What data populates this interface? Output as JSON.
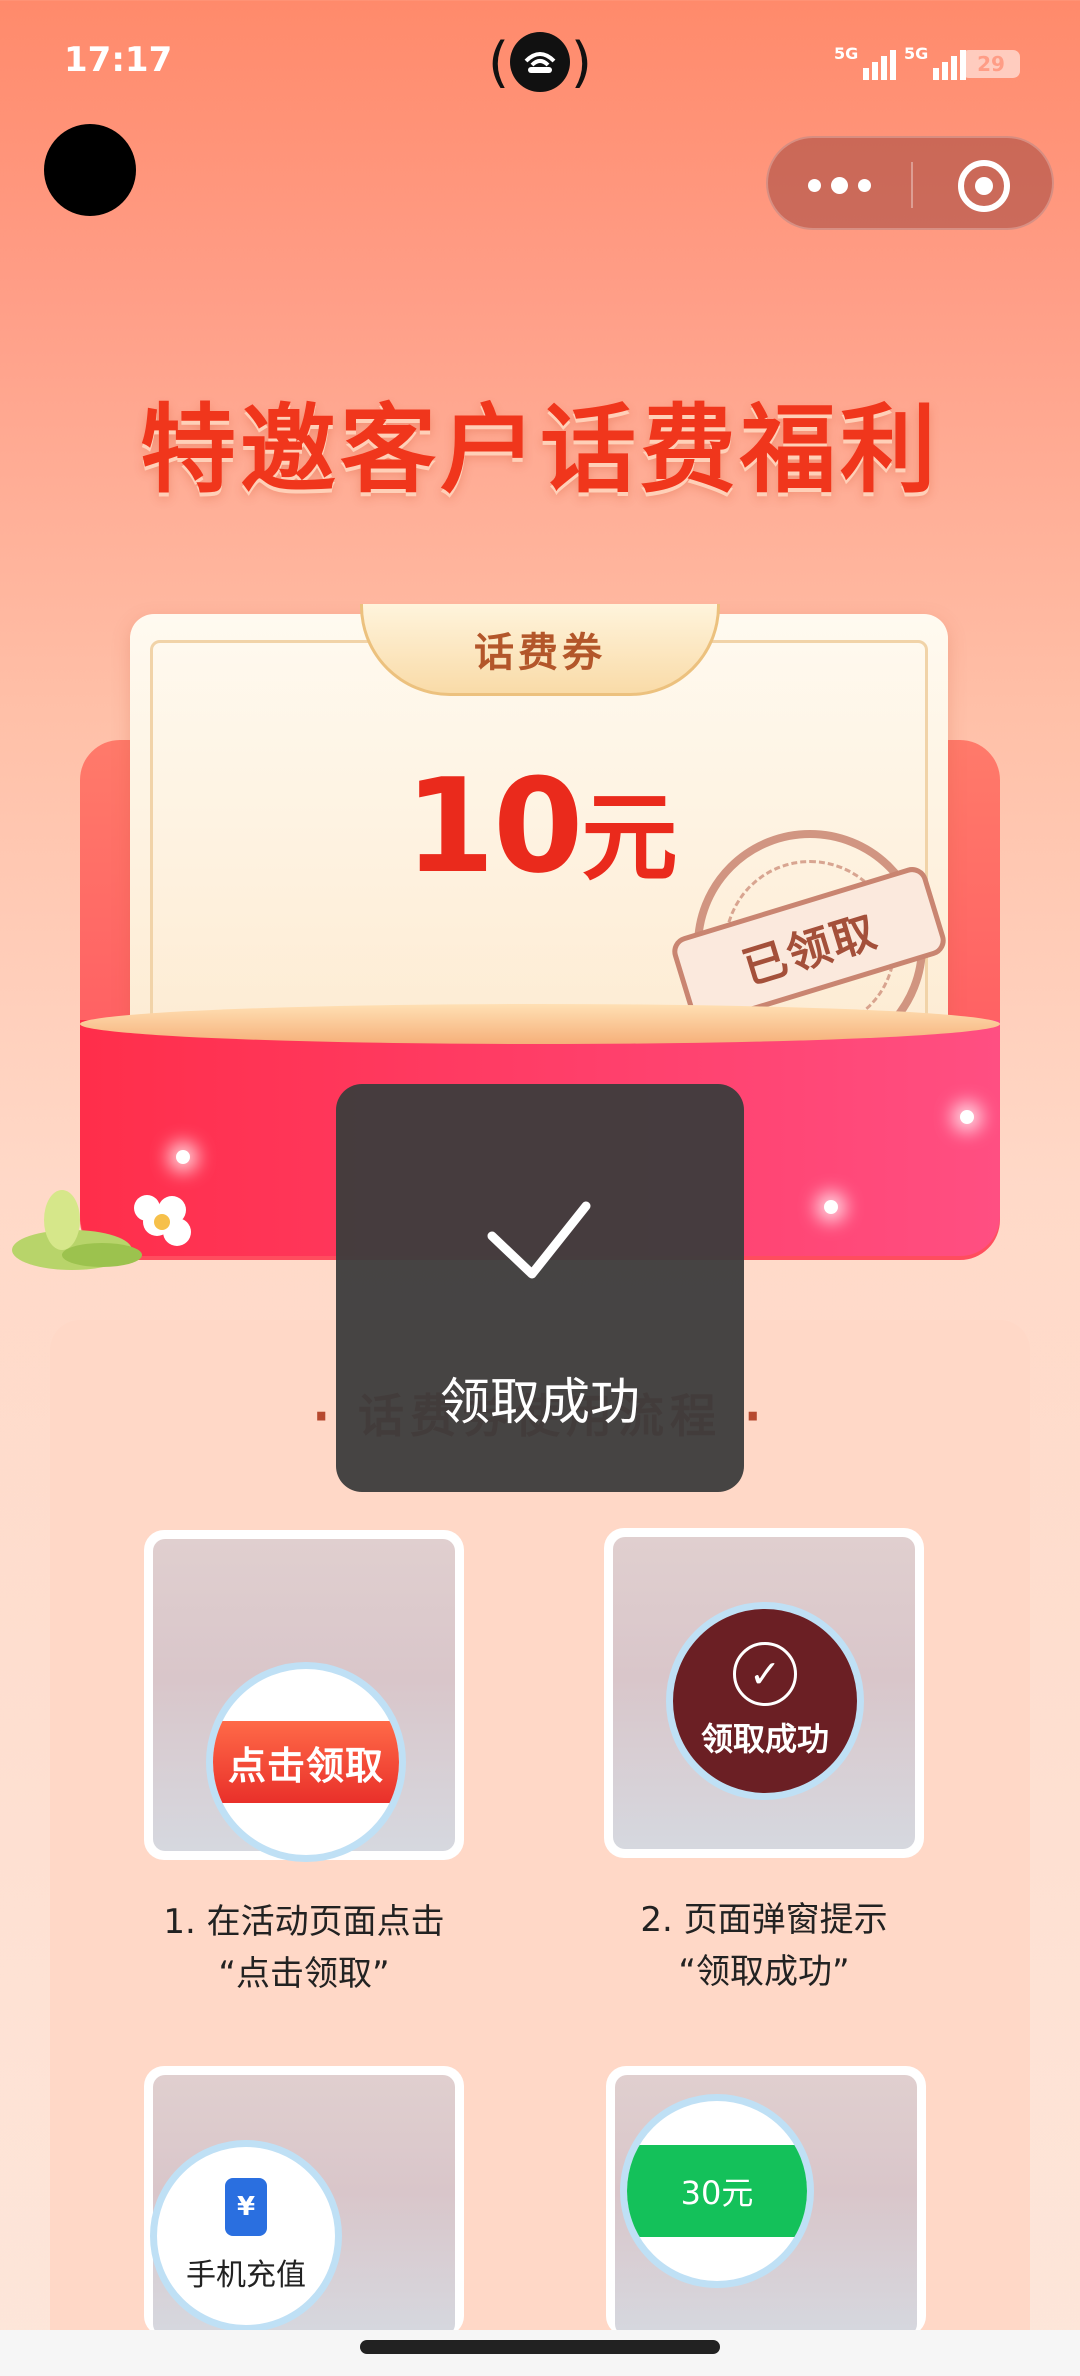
{
  "status_bar": {
    "time": "17:17",
    "signal_1_label": "5G",
    "signal_2_label": "5G",
    "battery": "29"
  },
  "page": {
    "title": "特邀客户话费福利"
  },
  "coupon": {
    "tab_label": "话费券",
    "amount": "10",
    "unit": "元",
    "stamp_label": "已领取"
  },
  "flow": {
    "title": "· 话费券使用流程 ·",
    "steps": [
      {
        "lens_text": "点击领取",
        "caption_line1": "1. 在活动页面点击",
        "caption_line2": "“点击领取”"
      },
      {
        "lens_text": "领取成功",
        "caption_line1": "2. 页面弹窗提示",
        "caption_line2": "“领取成功”"
      },
      {
        "lens_text": "手机充值"
      },
      {
        "lens_text": "30元"
      }
    ]
  },
  "toast": {
    "text": "领取成功"
  },
  "colors": {
    "brand_red": "#f0361c",
    "toast_bg": "#3c3c3c",
    "success_green": "#14c15a"
  }
}
